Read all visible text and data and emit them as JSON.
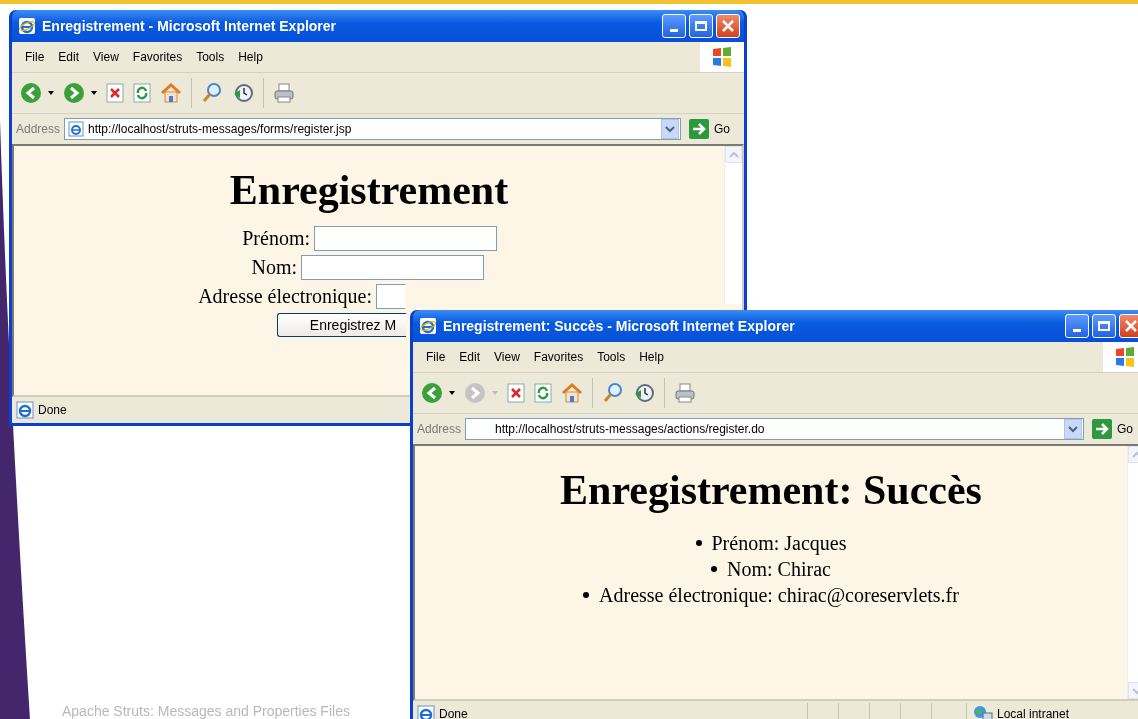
{
  "slide": {
    "footer": "Apache Struts: Messages and Properties Files"
  },
  "windows": [
    {
      "title": "Enregistrement - Microsoft Internet Explorer",
      "menu": [
        "File",
        "Edit",
        "View",
        "Favorites",
        "Tools",
        "Help"
      ],
      "forward_disabled": false,
      "address_label": "Address",
      "address": "http://localhost/struts-messages/forms/register.jsp",
      "go": "Go",
      "page": {
        "kind": "form",
        "heading": "Enregistrement",
        "fields": [
          {
            "label": "Prénom:"
          },
          {
            "label": "Nom:"
          },
          {
            "label": "Adresse électronique:"
          }
        ],
        "button": "Enregistrez M"
      },
      "status": "Done"
    },
    {
      "title": "Enregistrement: Succès - Microsoft Internet Explorer",
      "menu": [
        "File",
        "Edit",
        "View",
        "Favorites",
        "Tools",
        "Help"
      ],
      "forward_disabled": true,
      "address_label": "Address",
      "address": "http://localhost/struts-messages/actions/register.do",
      "go": "Go",
      "page": {
        "kind": "list",
        "heading": "Enregistrement: Succès",
        "items": [
          "Prénom: Jacques",
          "Nom: Chirac",
          "Adresse électronique: chirac@coreservlets.fr"
        ]
      },
      "status": "Done",
      "zone": "Local intranet"
    }
  ]
}
